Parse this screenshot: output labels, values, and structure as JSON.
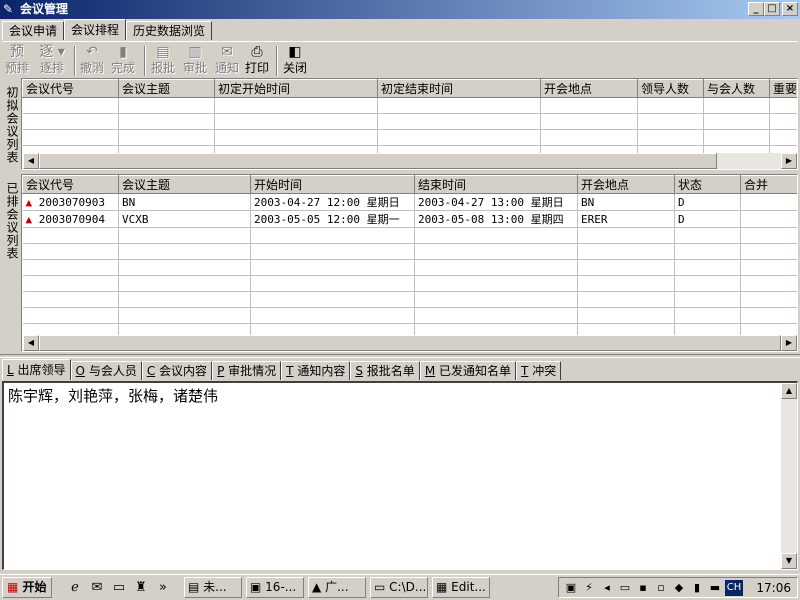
{
  "window": {
    "title": "会议管理",
    "controls": [
      "_",
      "□",
      "×"
    ]
  },
  "top_tabs": [
    "会议申请",
    "会议排程",
    "历史数据浏览"
  ],
  "toolbar": [
    {
      "label": "预排",
      "icon": "预",
      "enabled": false
    },
    {
      "label": "逐排",
      "icon": "逐",
      "enabled": false
    },
    {
      "label": "撤消",
      "icon": "↶",
      "enabled": false
    },
    {
      "label": "完成",
      "icon": "▮",
      "enabled": false
    },
    {
      "label": "报批",
      "icon": "▤",
      "enabled": false
    },
    {
      "label": "审批",
      "icon": "▥",
      "enabled": false
    },
    {
      "label": "通知",
      "icon": "✉",
      "enabled": false
    },
    {
      "label": "打印",
      "icon": "⎙",
      "enabled": true
    },
    {
      "label": "关闭",
      "icon": "◧",
      "enabled": true
    }
  ],
  "draft_panel": {
    "side_label": "初拟会议列表",
    "columns": [
      "会议代号",
      "会议主题",
      "初定开始时间",
      "初定结束时间",
      "开会地点",
      "领导人数",
      "与会人数",
      "重要"
    ],
    "rows": []
  },
  "scheduled_panel": {
    "side_label": "已排会议列表",
    "columns": [
      "会议代号",
      "会议主题",
      "开始时间",
      "结束时间",
      "开会地点",
      "状态",
      "合并"
    ],
    "rows": [
      {
        "code": "2003070903",
        "topic": "BN",
        "start": "2003-04-27 12:00 星期日",
        "end": "2003-04-27 13:00 星期日",
        "location": "BN",
        "status": "D",
        "merge": ""
      },
      {
        "code": "2003070904",
        "topic": "VCXB",
        "start": "2003-05-05 12:00 星期一",
        "end": "2003-05-08 13:00 星期四",
        "location": "ERER",
        "status": "D",
        "merge": ""
      }
    ]
  },
  "bottom_tabs": [
    {
      "key": "L",
      "label": "出席领导"
    },
    {
      "key": "O",
      "label": "与会人员"
    },
    {
      "key": "C",
      "label": "会议内容"
    },
    {
      "key": "P",
      "label": "审批情况"
    },
    {
      "key": "T",
      "label": "通知内容"
    },
    {
      "key": "S",
      "label": "报批名单"
    },
    {
      "key": "M",
      "label": "已发通知名单"
    },
    {
      "key": "T",
      "label": "冲突"
    }
  ],
  "content_text": "陈宇辉，刘艳萍，张梅，诸楚伟",
  "taskbar": {
    "start_label": "开始",
    "tasks": [
      "未...",
      "16-...",
      "广...",
      "C:\\D...",
      "Edit..."
    ],
    "tray_lang": "CH",
    "clock": "17:06"
  }
}
